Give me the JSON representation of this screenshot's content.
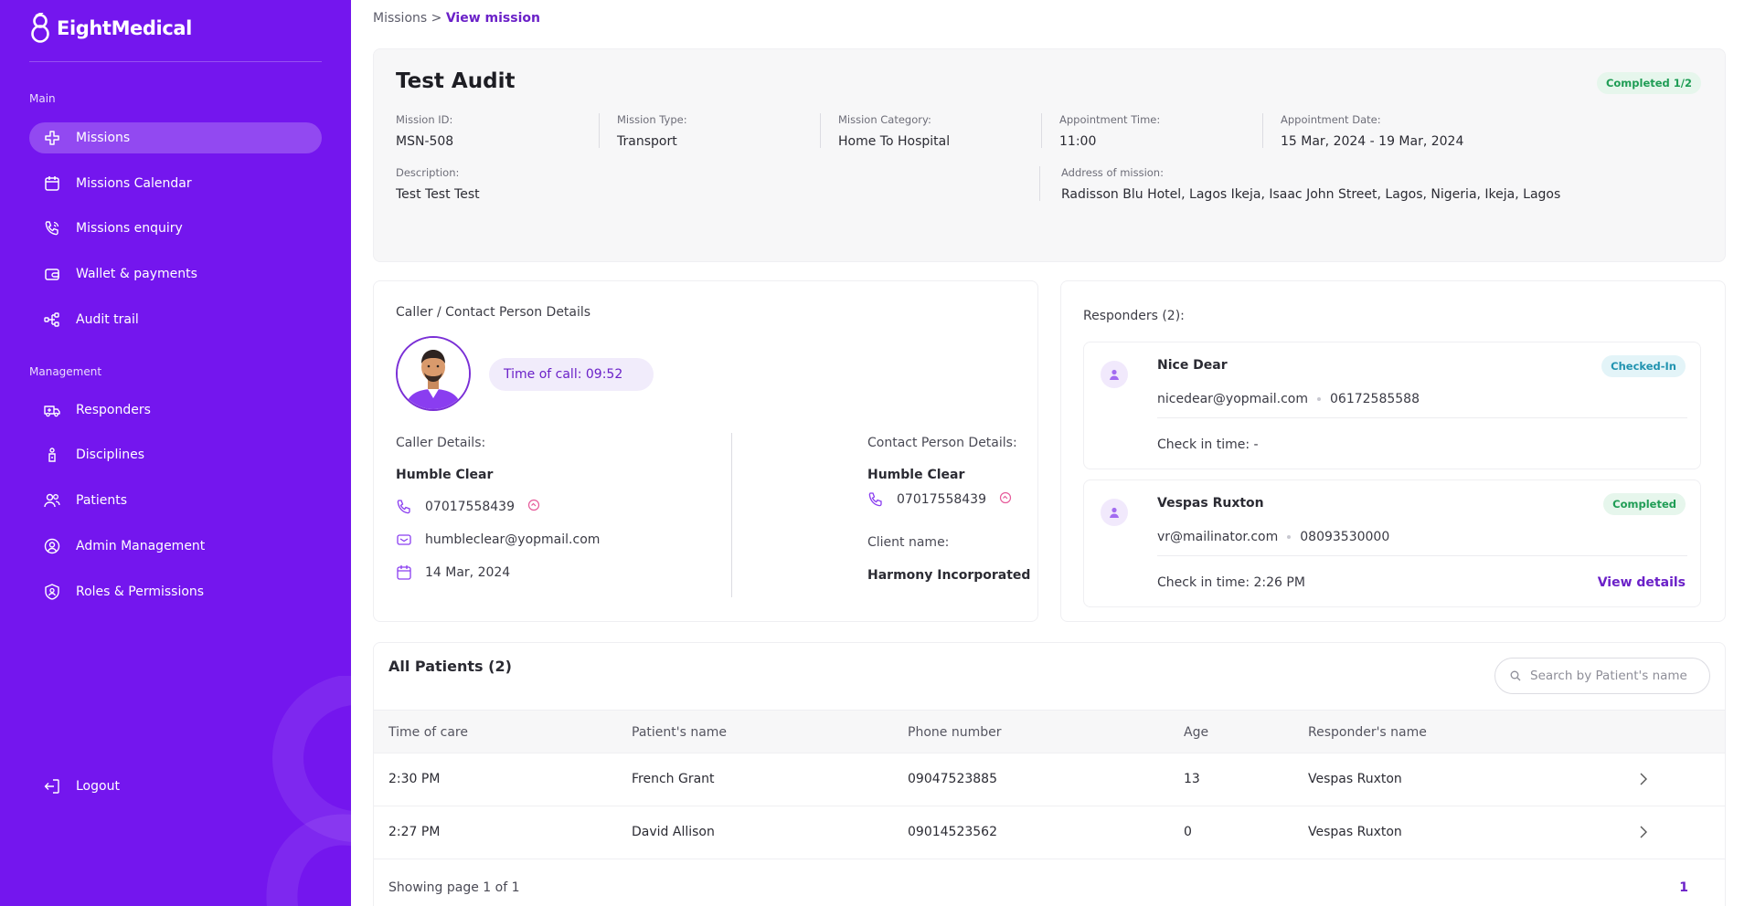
{
  "brand": {
    "name": "EightMedical"
  },
  "sidebar": {
    "main_label": "Main",
    "management_label": "Management",
    "main_items": [
      {
        "label": "Missions",
        "icon": "cross-icon",
        "active": true
      },
      {
        "label": "Missions Calendar",
        "icon": "calendar-icon"
      },
      {
        "label": "Missions enquiry",
        "icon": "phone-call-icon"
      },
      {
        "label": "Wallet & payments",
        "icon": "wallet-icon"
      },
      {
        "label": "Audit trail",
        "icon": "tree-icon"
      }
    ],
    "management_items": [
      {
        "label": "Responders",
        "icon": "ambulance-icon"
      },
      {
        "label": "Disciplines",
        "icon": "badge-icon"
      },
      {
        "label": "Patients",
        "icon": "people-icon"
      },
      {
        "label": "Admin Management",
        "icon": "user-circle-icon"
      },
      {
        "label": "Roles & Permissions",
        "icon": "shield-user-icon"
      }
    ],
    "logout": "Logout"
  },
  "breadcrumb": {
    "parent": "Missions",
    "separator": ">",
    "current": "View mission"
  },
  "mission": {
    "title": "Test Audit",
    "status": "Completed 1/2",
    "fields": {
      "id": {
        "label": "Mission ID:",
        "value": "MSN-508"
      },
      "type": {
        "label": "Mission Type:",
        "value": "Transport"
      },
      "category": {
        "label": "Mission Category:",
        "value": "Home To Hospital"
      },
      "time": {
        "label": "Appointment Time:",
        "value": "11:00"
      },
      "date": {
        "label": "Appointment Date:",
        "value": "15 Mar, 2024 - 19 Mar, 2024"
      },
      "description": {
        "label": "Description:",
        "value": "Test Test Test"
      },
      "address": {
        "label": "Address of mission:",
        "value": "Radisson Blu Hotel, Lagos Ikeja, Isaac John Street, Lagos, Nigeria, Ikeja, Lagos"
      }
    }
  },
  "caller": {
    "title": "Caller / Contact Person Details",
    "time_of_call": "Time of call: 09:52",
    "caller_details_label": "Caller Details:",
    "caller_name": "Humble Clear",
    "caller_phone": "07017558439",
    "caller_email": "humbleclear@yopmail.com",
    "caller_date": "14 Mar, 2024",
    "contact_label": "Contact Person Details:",
    "contact_name": "Humble Clear",
    "contact_phone": "07017558439",
    "client_label": "Client name:",
    "client_name": "Harmony Incorporated"
  },
  "responders": {
    "title": "Responders (2):",
    "items": [
      {
        "name": "Nice Dear",
        "email": "nicedear@yopmail.com",
        "phone": "06172585588",
        "status": "Checked-In",
        "check_in": "Check in time: -"
      },
      {
        "name": "Vespas Ruxton",
        "email": "vr@mailinator.com",
        "phone": "08093530000",
        "status": "Completed",
        "check_in": "Check in time: 2:26 PM",
        "action": "View details"
      }
    ]
  },
  "patients": {
    "title": "All Patients (2)",
    "search_placeholder": "Search by Patient's name",
    "columns": [
      "Time of care",
      "Patient's name",
      "Phone number",
      "Age",
      "Responder's name"
    ],
    "rows": [
      [
        "2:30 PM",
        "French Grant",
        "09047523885",
        "13",
        "Vespas Ruxton"
      ],
      [
        "2:27 PM",
        "David Allison",
        "09014523562",
        "0",
        "Vespas Ruxton"
      ]
    ],
    "page_info": "Showing page 1 of 1",
    "current_page": "1"
  },
  "colors": {
    "brand": "#7416ee",
    "accent": "#6b21c8",
    "success": "#1f9d55",
    "info": "#2193b0"
  }
}
